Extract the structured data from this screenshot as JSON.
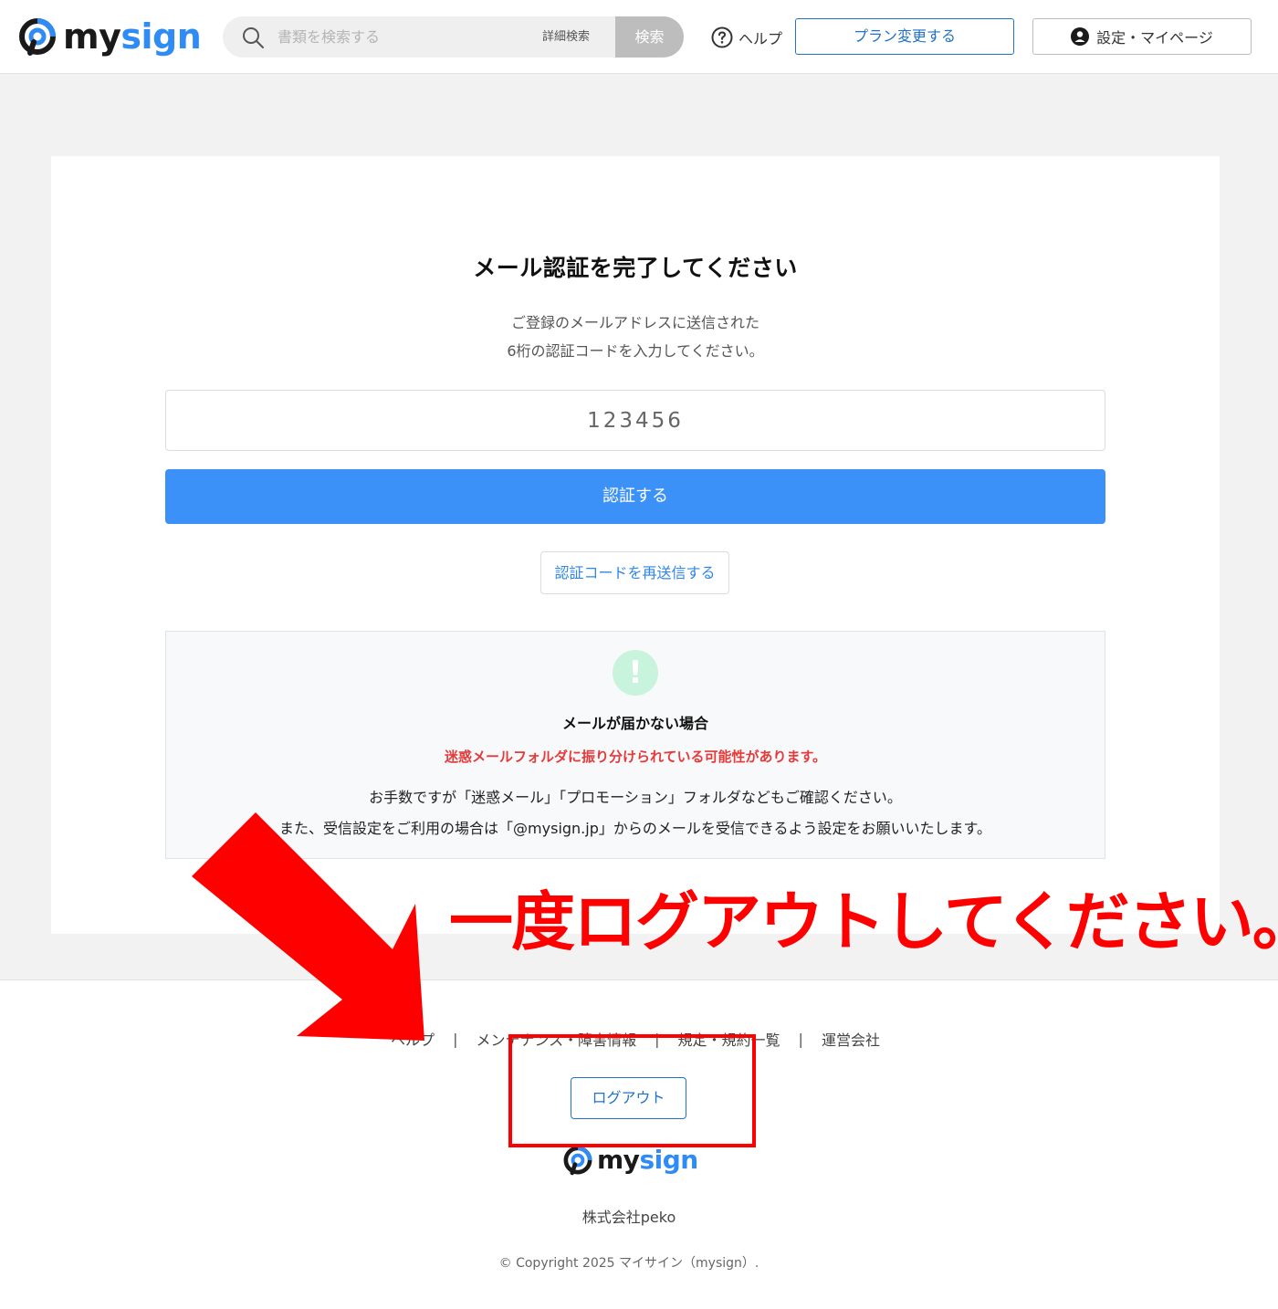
{
  "header": {
    "logo": {
      "my": "my",
      "sign": "sign"
    },
    "search": {
      "placeholder": "書類を検索する",
      "advanced_label": "詳細検索",
      "button_label": "検索"
    },
    "help_label": "ヘルプ",
    "plan_button_label": "プラン変更する",
    "settings_button_label": "設定・マイページ"
  },
  "main": {
    "title": "メール認証を完了してください",
    "description_line1": "ご登録のメールアドレスに送信された",
    "description_line2": "6桁の認証コードを入力してください。",
    "code_input": {
      "placeholder": "123456",
      "value": ""
    },
    "verify_button_label": "認証する",
    "resend_button_label": "認証コードを再送信する",
    "notice": {
      "icon_symbol": "!",
      "title": "メールが届かない場合",
      "warning": "迷惑メールフォルダに振り分けられている可能性があります。",
      "line1": "お手数ですが「迷惑メール」「プロモーション」フォルダなどもご確認ください。",
      "line2": "また、受信設定をご利用の場合は「@mysign.jp」からのメールを受信できるよう設定をお願いいたします。"
    }
  },
  "footer": {
    "links": [
      "ヘルプ",
      "メンテナンス・障害情報",
      "規定・規約一覧",
      "運営会社"
    ],
    "separator": "|",
    "logout_button_label": "ログアウト",
    "logo": {
      "my": "my",
      "sign": "sign"
    },
    "company": "株式会社peko",
    "copyright": "© Copyright 2025 マイサイン（mysign）."
  },
  "annotation": {
    "text": "一度ログアウトしてください。",
    "color": "#ff0000"
  },
  "colors": {
    "brand_blue": "#2f8cf5",
    "primary_button": "#3b91f7",
    "outline_blue": "#2172c9",
    "warning_red": "#e53a3a",
    "notice_icon_bg": "#c8f3dc"
  }
}
